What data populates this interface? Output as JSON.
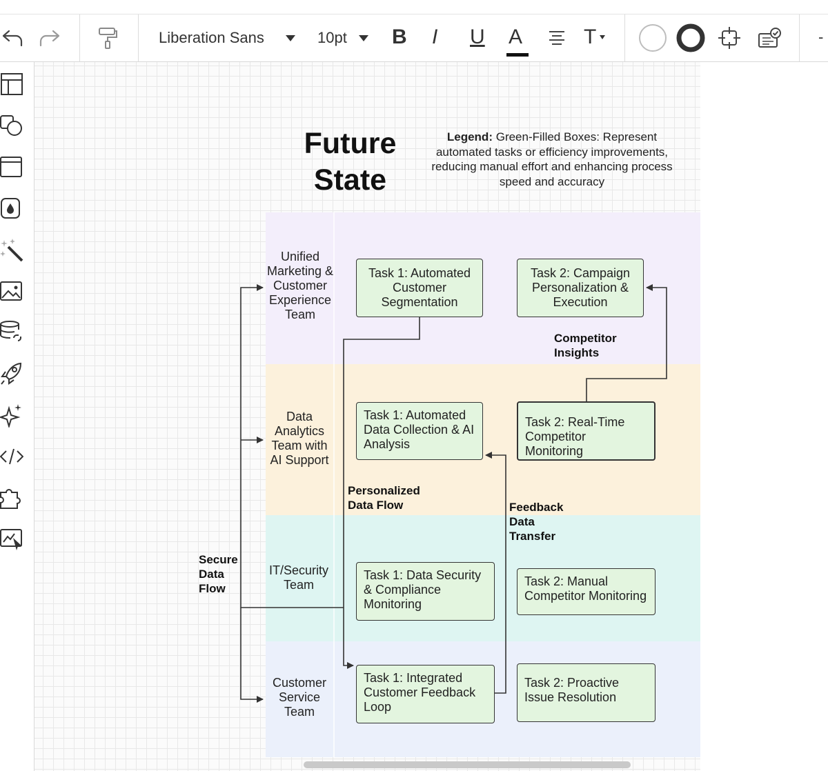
{
  "toolbar": {
    "font_family": "Liberation Sans",
    "font_size": "10pt",
    "bold_label": "B",
    "italic_label": "I",
    "underline_label": "U",
    "font_color_label": "A",
    "text_options_label": "T",
    "overflow_label": "-",
    "icons": [
      "undo-icon",
      "redo-icon",
      "format-painter-icon",
      "align-text-icon",
      "fill-color-icon",
      "line-style-icon",
      "crop-icon",
      "data-linking-icon"
    ]
  },
  "sidebar": {
    "icons": [
      "page-layout-icon",
      "shapes-icon",
      "container-icon",
      "fill-drop-icon",
      "magic-wand-icon",
      "image-icon",
      "data-link-icon",
      "rocket-icon",
      "sparkle-icon",
      "code-icon",
      "puzzle-icon",
      "presentation-icon"
    ]
  },
  "diagram": {
    "title_line1": "Future",
    "title_line2": "State",
    "legend_label": "Legend:",
    "legend_text": "Green-Filled Boxes: Represent automated tasks or efficiency improvements, reducing manual effort and enhancing process speed and accuracy",
    "lanes": [
      {
        "label": "Unified Marketing & Customer Experience Team",
        "color": "#f3eefb"
      },
      {
        "label": "Data Analytics Team with AI Support",
        "color": "#fcf1dc"
      },
      {
        "label": "IT/Security Team",
        "color": "#def5f2"
      },
      {
        "label": "Customer Service Team",
        "color": "#ebf0fb"
      }
    ],
    "tasks": {
      "marketing_1": "Task 1: Automated Customer Segmentation",
      "marketing_2": "Task 2: Campaign Personalization & Execution",
      "analytics_1": "Task 1: Automated Data Collection & AI Analysis",
      "analytics_2": "Task 2: Real-Time Competitor Monitoring",
      "security_1": "Task 1: Data Security & Compliance Monitoring",
      "security_2": "Task 2: Manual Competitor Monitoring",
      "service_1": "Task 1: Integrated Customer Feedback Loop",
      "service_2": "Task 2: Proactive Issue Resolution"
    },
    "connector_labels": {
      "competitor_insights": "Competitor Insights",
      "personalized_data_flow": "Personalized Data Flow",
      "feedback_data_transfer": "Feedback Data Transfer",
      "secure_data_flow": "Secure Data Flow"
    },
    "task_fill_color": "#e3f5df"
  }
}
